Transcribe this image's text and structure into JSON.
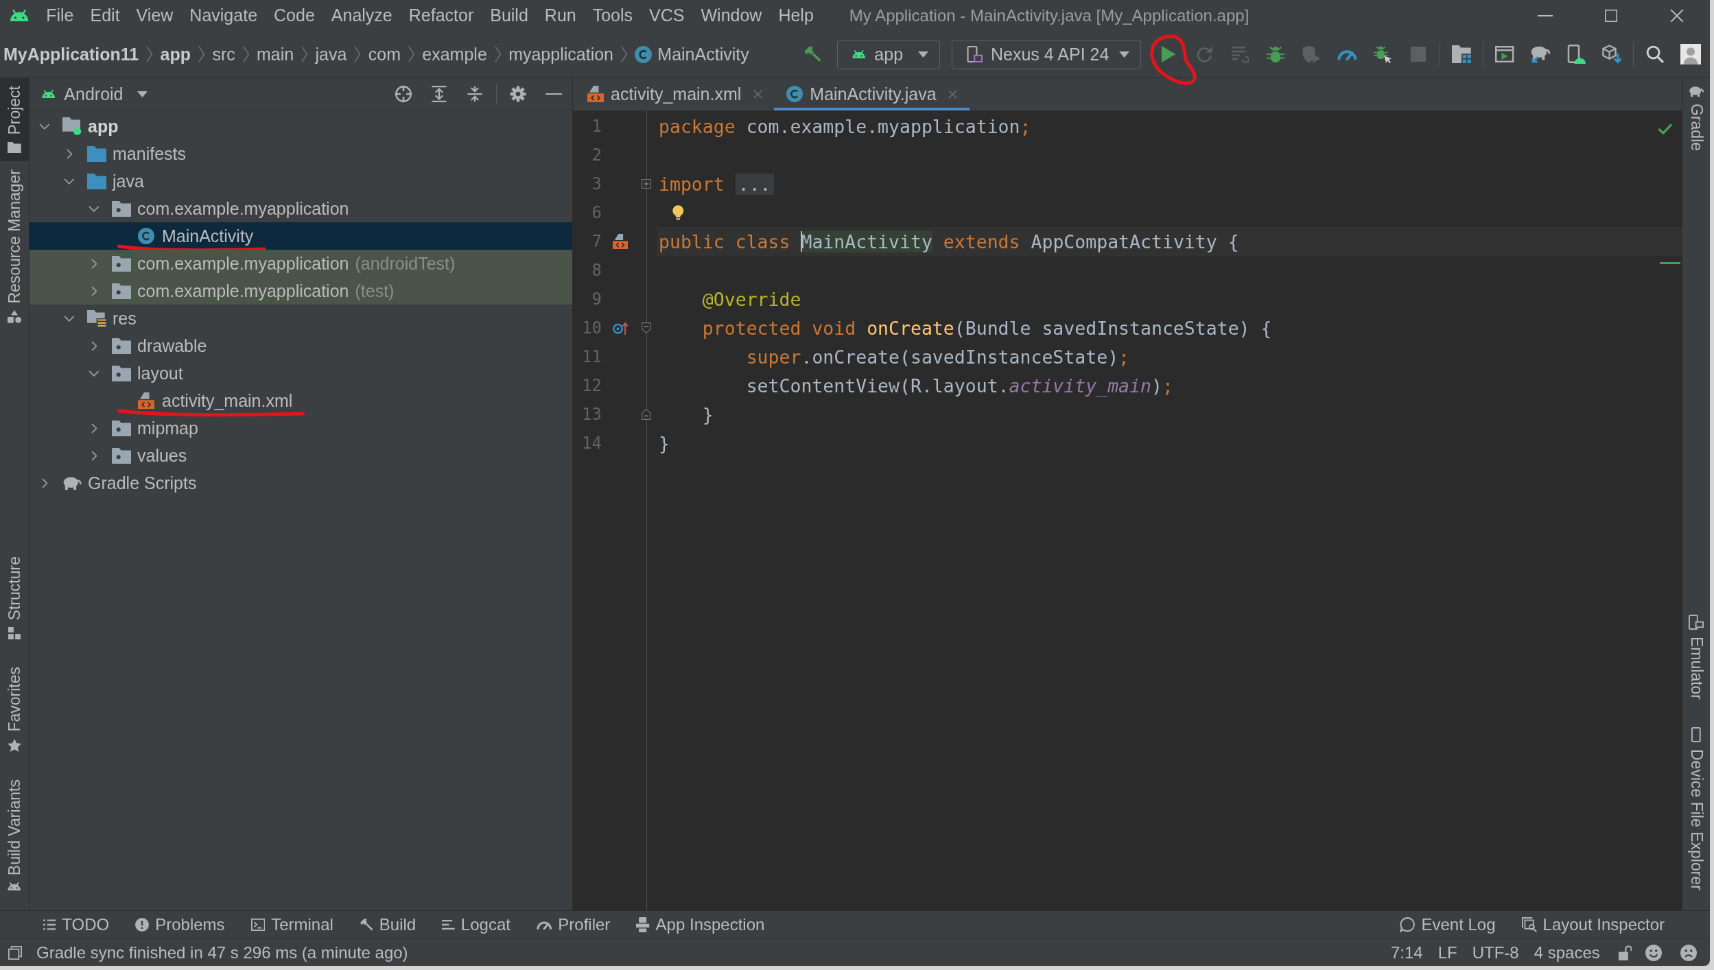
{
  "window": {
    "title": "My Application - MainActivity.java [My_Application.app]",
    "menu": [
      "File",
      "Edit",
      "View",
      "Navigate",
      "Code",
      "Analyze",
      "Refactor",
      "Build",
      "Run",
      "Tools",
      "VCS",
      "Window",
      "Help"
    ]
  },
  "breadcrumb": [
    {
      "label": "MyApplication11",
      "kind": "project"
    },
    {
      "label": "app",
      "kind": "module"
    },
    {
      "label": "src",
      "kind": "folder"
    },
    {
      "label": "main",
      "kind": "folder"
    },
    {
      "label": "java",
      "kind": "folder"
    },
    {
      "label": "com",
      "kind": "folder"
    },
    {
      "label": "example",
      "kind": "folder"
    },
    {
      "label": "myapplication",
      "kind": "folder"
    },
    {
      "label": "MainActivity",
      "kind": "class"
    }
  ],
  "toolbar": {
    "items": [
      {
        "kind": "make",
        "disabled": false,
        "circled": false
      },
      {
        "kind": "run-config",
        "label": "app"
      },
      {
        "kind": "device",
        "label": "Nexus 4 API 24"
      },
      {
        "kind": "run",
        "disabled": false,
        "circled": true
      },
      {
        "kind": "rerun",
        "disabled": true,
        "circled": false
      },
      {
        "kind": "apply-changes",
        "disabled": true,
        "circled": false
      },
      {
        "kind": "debug",
        "disabled": false,
        "circled": false
      },
      {
        "kind": "coverage",
        "disabled": true,
        "circled": false
      },
      {
        "kind": "profile",
        "disabled": false,
        "circled": false
      },
      {
        "kind": "debug-attach",
        "disabled": false,
        "circled": false
      },
      {
        "kind": "stop",
        "disabled": true,
        "circled": false
      },
      {
        "kind": "separator"
      },
      {
        "kind": "project-structure",
        "disabled": false,
        "circled": false
      },
      {
        "kind": "separator"
      },
      {
        "kind": "run-window",
        "disabled": false,
        "circled": false
      },
      {
        "kind": "gradle-sync",
        "disabled": false,
        "circled": false
      },
      {
        "kind": "device-manager",
        "disabled": false,
        "circled": false
      },
      {
        "kind": "sdk-manager",
        "disabled": false,
        "circled": false
      },
      {
        "kind": "separator"
      },
      {
        "kind": "search",
        "disabled": false,
        "circled": false
      },
      {
        "kind": "account",
        "disabled": false,
        "circled": false
      }
    ]
  },
  "left_strip": {
    "top": [
      {
        "label": "Project",
        "kind": "project",
        "selected": true
      },
      {
        "label": "Resource Manager",
        "kind": "resources",
        "selected": false
      }
    ],
    "bottom": [
      {
        "label": "Structure",
        "kind": "structure",
        "selected": false
      },
      {
        "label": "Favorites",
        "kind": "favorites",
        "selected": false
      },
      {
        "label": "Build Variants",
        "kind": "build-variants",
        "selected": false
      }
    ]
  },
  "project_panel": {
    "view": "Android",
    "tree": [
      {
        "label": "app",
        "kind": "module",
        "expanded": true,
        "selected": false,
        "test_scope": false,
        "underlined": false,
        "children": [
          {
            "label": "manifests",
            "kind": "source-folder",
            "expanded": false,
            "selected": false,
            "test_scope": false,
            "underlined": false
          },
          {
            "label": "java",
            "kind": "source-folder",
            "expanded": true,
            "selected": false,
            "test_scope": false,
            "underlined": false,
            "children": [
              {
                "label": "com.example.myapplication",
                "kind": "folder",
                "expanded": true,
                "selected": false,
                "test_scope": false,
                "underlined": false,
                "children": [
                  {
                    "label": "MainActivity",
                    "kind": "class",
                    "selected": true,
                    "test_scope": false,
                    "underlined": true
                  }
                ]
              },
              {
                "label": "com.example.myapplication",
                "note": "(androidTest)",
                "kind": "folder",
                "expanded": false,
                "selected": false,
                "test_scope": true,
                "underlined": false
              },
              {
                "label": "com.example.myapplication",
                "note": "(test)",
                "kind": "folder",
                "expanded": false,
                "selected": false,
                "test_scope": true,
                "underlined": false
              }
            ]
          },
          {
            "label": "res",
            "kind": "res-folder",
            "expanded": true,
            "selected": false,
            "test_scope": false,
            "underlined": false,
            "children": [
              {
                "label": "drawable",
                "kind": "folder",
                "expanded": false,
                "selected": false,
                "test_scope": false,
                "underlined": false
              },
              {
                "label": "layout",
                "kind": "folder",
                "expanded": true,
                "selected": false,
                "test_scope": false,
                "underlined": false,
                "children": [
                  {
                    "label": "activity_main.xml",
                    "kind": "layout-file",
                    "selected": false,
                    "test_scope": false,
                    "underlined": true
                  }
                ]
              },
              {
                "label": "mipmap",
                "kind": "folder",
                "expanded": false,
                "selected": false,
                "test_scope": false,
                "underlined": false
              },
              {
                "label": "values",
                "kind": "folder",
                "expanded": false,
                "selected": false,
                "test_scope": false,
                "underlined": false
              }
            ]
          }
        ]
      },
      {
        "label": "Gradle Scripts",
        "kind": "gradle",
        "expanded": false,
        "selected": false,
        "test_scope": false,
        "underlined": false
      }
    ]
  },
  "editor": {
    "tabs": [
      {
        "label": "activity_main.xml",
        "kind": "layout-file",
        "selected": false
      },
      {
        "label": "MainActivity.java",
        "kind": "class",
        "selected": true
      }
    ],
    "inspections_passed": true,
    "lines": [
      {
        "number": "1",
        "current": false,
        "bulb": false,
        "tokens": [
          {
            "text": "package",
            "kind": "keyword"
          },
          {
            "text": " com.example.myapplication",
            "kind": "plain"
          },
          {
            "text": ";",
            "kind": "keyword"
          }
        ]
      },
      {
        "number": "2",
        "current": false,
        "bulb": false
      },
      {
        "number": "3",
        "current": false,
        "bulb": false,
        "fold": {
          "kind": "collapsed"
        },
        "tokens": [
          {
            "text": "import ",
            "kind": "keyword"
          },
          {
            "text": "...",
            "kind": "folded"
          }
        ]
      },
      {
        "number": "6",
        "current": false,
        "bulb": true
      },
      {
        "number": "7",
        "current": true,
        "bulb": false,
        "gutter": {
          "kind": "layout-file"
        },
        "tokens": [
          {
            "text": "public class ",
            "kind": "keyword"
          },
          {
            "text": "MainActivity",
            "kind": "usage",
            "caret": true
          },
          {
            "text": " extends ",
            "kind": "keyword"
          },
          {
            "text": "AppCompatActivity {",
            "kind": "plain"
          }
        ]
      },
      {
        "number": "8",
        "current": false,
        "bulb": false
      },
      {
        "number": "9",
        "current": false,
        "bulb": false,
        "tokens": [
          {
            "text": "    @Override",
            "kind": "annotation"
          }
        ]
      },
      {
        "number": "10",
        "current": false,
        "bulb": false,
        "gutter": {
          "kind": "override"
        },
        "fold": {
          "kind": "start"
        },
        "tokens": [
          {
            "text": "    protected void ",
            "kind": "keyword"
          },
          {
            "text": "onCreate",
            "kind": "function"
          },
          {
            "text": "(Bundle savedInstanceState) {",
            "kind": "plain"
          }
        ]
      },
      {
        "number": "11",
        "current": false,
        "bulb": false,
        "tokens": [
          {
            "text": "        super",
            "kind": "keyword"
          },
          {
            "text": ".onCreate(savedInstanceState)",
            "kind": "plain"
          },
          {
            "text": ";",
            "kind": "keyword"
          }
        ]
      },
      {
        "number": "12",
        "current": false,
        "bulb": false,
        "tokens": [
          {
            "text": "        setContentView(R.layout.",
            "kind": "plain"
          },
          {
            "text": "activity_main",
            "kind": "field"
          },
          {
            "text": ")",
            "kind": "plain"
          },
          {
            "text": ";",
            "kind": "keyword"
          }
        ]
      },
      {
        "number": "13",
        "current": false,
        "bulb": false,
        "fold": {
          "kind": "end"
        },
        "tokens": [
          {
            "text": "    }",
            "kind": "plain"
          }
        ]
      },
      {
        "number": "14",
        "current": false,
        "bulb": false,
        "tokens": [
          {
            "text": "}",
            "kind": "plain"
          }
        ]
      }
    ]
  },
  "right_strip": {
    "top": [
      {
        "label": "Gradle",
        "kind": "gradle",
        "selected": false
      }
    ],
    "bottom": [
      {
        "label": "Emulator",
        "kind": "emulator",
        "selected": false
      },
      {
        "label": "Device File Explorer",
        "kind": "device-explorer",
        "selected": false
      }
    ]
  },
  "tool_windows": {
    "left": [
      {
        "label": "TODO",
        "kind": "todo"
      },
      {
        "label": "Problems",
        "kind": "problems"
      },
      {
        "label": "Terminal",
        "kind": "terminal"
      },
      {
        "label": "Build",
        "kind": "build"
      },
      {
        "label": "Logcat",
        "kind": "logcat"
      },
      {
        "label": "Profiler",
        "kind": "profiler"
      },
      {
        "label": "App Inspection",
        "kind": "app-inspection"
      }
    ],
    "right": [
      {
        "label": "Event Log",
        "kind": "event-log"
      },
      {
        "label": "Layout Inspector",
        "kind": "layout-inspector"
      }
    ]
  },
  "status_bar": {
    "message": "Gradle sync finished in 47 s 296 ms (a minute ago)",
    "caret_position": "7:14",
    "line_separator": "LF",
    "encoding": "UTF-8",
    "indent": "4 spaces",
    "read_only": false
  }
}
